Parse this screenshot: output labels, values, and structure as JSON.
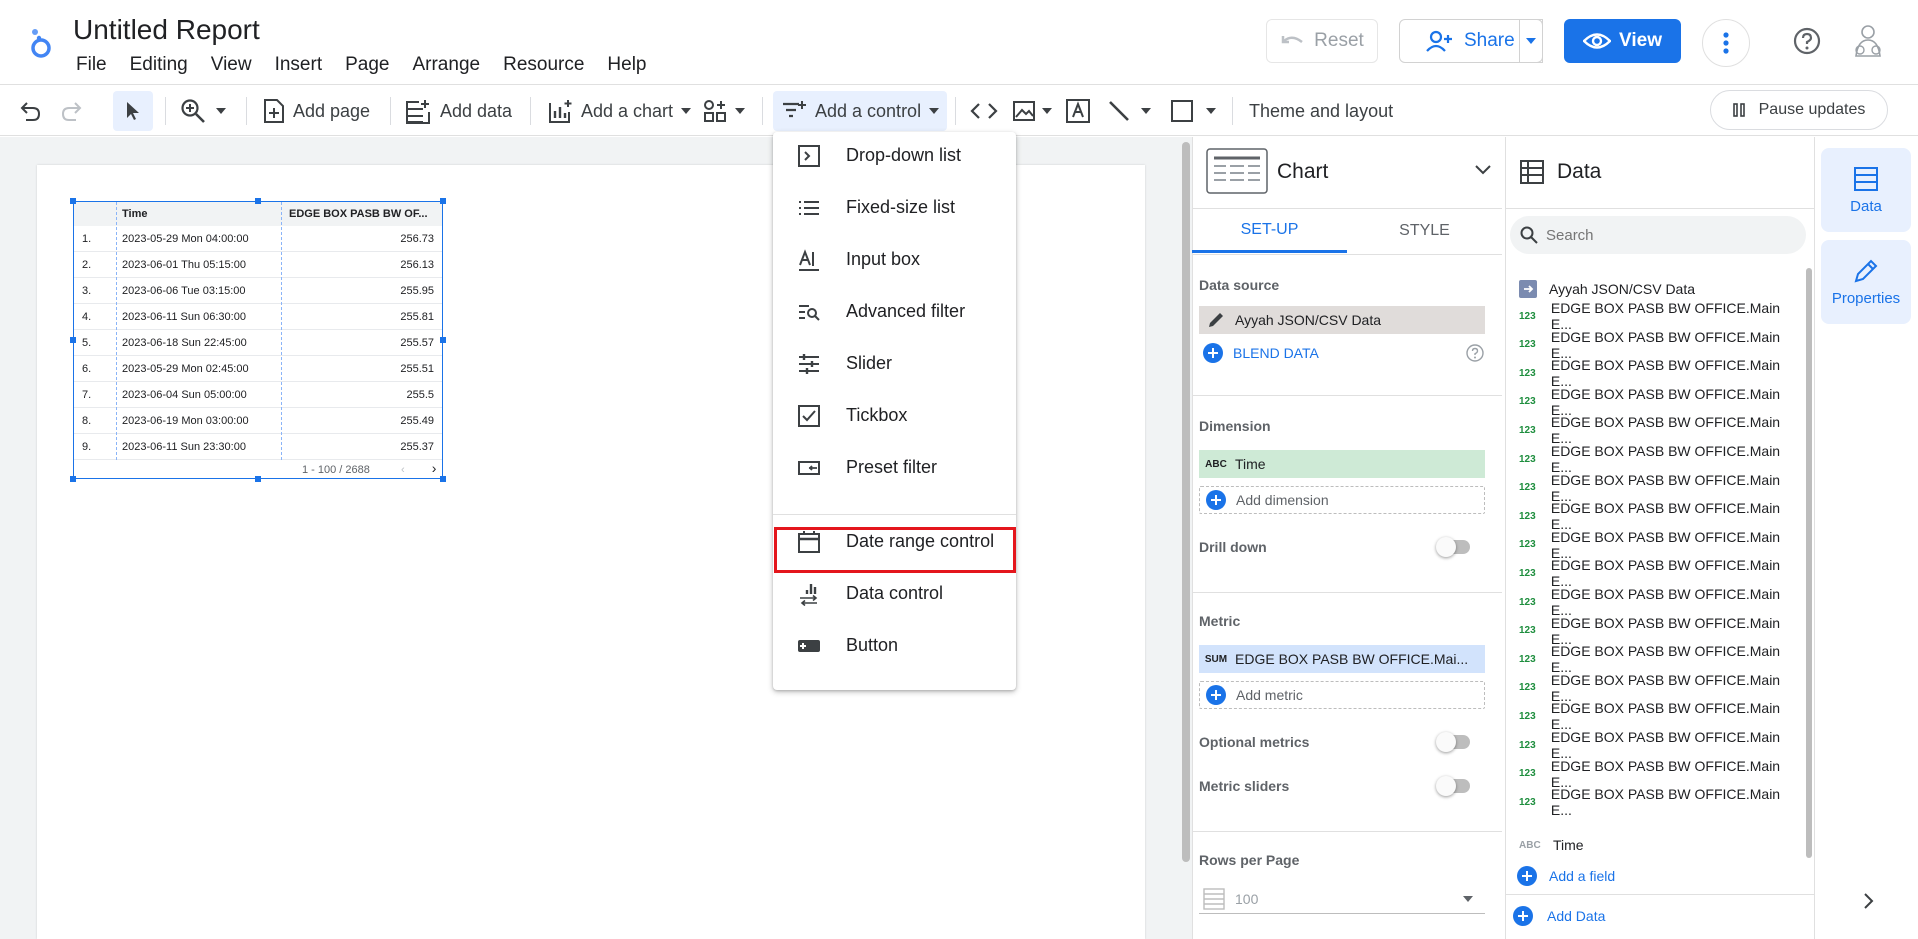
{
  "header": {
    "title": "Untitled Report",
    "menu": [
      "File",
      "Editing",
      "View",
      "Insert",
      "Page",
      "Arrange",
      "Resource",
      "Help"
    ],
    "reset_label": "Reset",
    "share_label": "Share",
    "view_label": "View"
  },
  "toolbar": {
    "add_page": "Add page",
    "add_data": "Add data",
    "add_chart": "Add a chart",
    "add_control": "Add a control",
    "theme_layout": "Theme and layout",
    "pause_updates": "Pause updates"
  },
  "table": {
    "columns": [
      "Time",
      "EDGE BOX PASB BW OF..."
    ],
    "rows": [
      {
        "n": "1.",
        "time": "2023-05-29 Mon 04:00:00",
        "value": "256.73"
      },
      {
        "n": "2.",
        "time": "2023-06-01 Thu 05:15:00",
        "value": "256.13"
      },
      {
        "n": "3.",
        "time": "2023-06-06 Tue 03:15:00",
        "value": "255.95"
      },
      {
        "n": "4.",
        "time": "2023-06-11 Sun 06:30:00",
        "value": "255.81"
      },
      {
        "n": "5.",
        "time": "2023-06-18 Sun 22:45:00",
        "value": "255.57"
      },
      {
        "n": "6.",
        "time": "2023-05-29 Mon 02:45:00",
        "value": "255.51"
      },
      {
        "n": "7.",
        "time": "2023-06-04 Sun 05:00:00",
        "value": "255.5"
      },
      {
        "n": "8.",
        "time": "2023-06-19 Mon 03:00:00",
        "value": "255.49"
      },
      {
        "n": "9.",
        "time": "2023-06-11 Sun 23:30:00",
        "value": "255.37"
      }
    ],
    "pagination": "1 - 100 / 2688"
  },
  "control_menu": {
    "items": [
      "Drop-down list",
      "Fixed-size list",
      "Input box",
      "Advanced filter",
      "Slider",
      "Tickbox",
      "Preset filter",
      "Date range control",
      "Data control",
      "Button"
    ],
    "highlighted": "Date range control"
  },
  "chart_panel": {
    "title": "Chart",
    "tabs": [
      "SET-UP",
      "STYLE"
    ],
    "active_tab": "SET-UP",
    "data_source_label": "Data source",
    "data_source": "Ayyah JSON/CSV Data",
    "blend_data": "BLEND DATA",
    "dimension_label": "Dimension",
    "dimension_badge": "ABC",
    "dimension": "Time",
    "add_dimension": "Add dimension",
    "drill_down": "Drill down",
    "metric_label": "Metric",
    "metric_badge": "SUM",
    "metric": "EDGE BOX PASB BW OFFICE.Mai...",
    "add_metric": "Add metric",
    "optional_metrics": "Optional metrics",
    "metric_sliders": "Metric sliders",
    "rows_per_page_label": "Rows per Page",
    "rows_per_page": "100"
  },
  "data_panel": {
    "title": "Data",
    "search_placeholder": "Search",
    "source": "Ayyah JSON/CSV Data",
    "number_badge": "123",
    "text_badge": "ABC",
    "fields": [
      "EDGE BOX PASB BW OFFICE.Main E...",
      "EDGE BOX PASB BW OFFICE.Main E...",
      "EDGE BOX PASB BW OFFICE.Main E...",
      "EDGE BOX PASB BW OFFICE.Main E...",
      "EDGE BOX PASB BW OFFICE.Main E...",
      "EDGE BOX PASB BW OFFICE.Main E...",
      "EDGE BOX PASB BW OFFICE.Main E...",
      "EDGE BOX PASB BW OFFICE.Main E...",
      "EDGE BOX PASB BW OFFICE.Main E...",
      "EDGE BOX PASB BW OFFICE.Main E...",
      "EDGE BOX PASB BW OFFICE.Main E...",
      "EDGE BOX PASB BW OFFICE.Main E...",
      "EDGE BOX PASB BW OFFICE.Main E...",
      "EDGE BOX PASB BW OFFICE.Main E...",
      "EDGE BOX PASB BW OFFICE.Main E...",
      "EDGE BOX PASB BW OFFICE.Main E...",
      "EDGE BOX PASB BW OFFICE.Main E...",
      "EDGE BOX PASB BW OFFICE.Main E..."
    ],
    "text_field": "Time",
    "add_field": "Add a field",
    "add_data": "Add Data"
  },
  "rail": {
    "data_label": "Data",
    "properties_label": "Properties"
  },
  "colors": {
    "accent": "#1a73e8",
    "highlight": "#e4161c",
    "dimension_green": "#ceead6",
    "metric_blue": "#d2e3fc"
  }
}
